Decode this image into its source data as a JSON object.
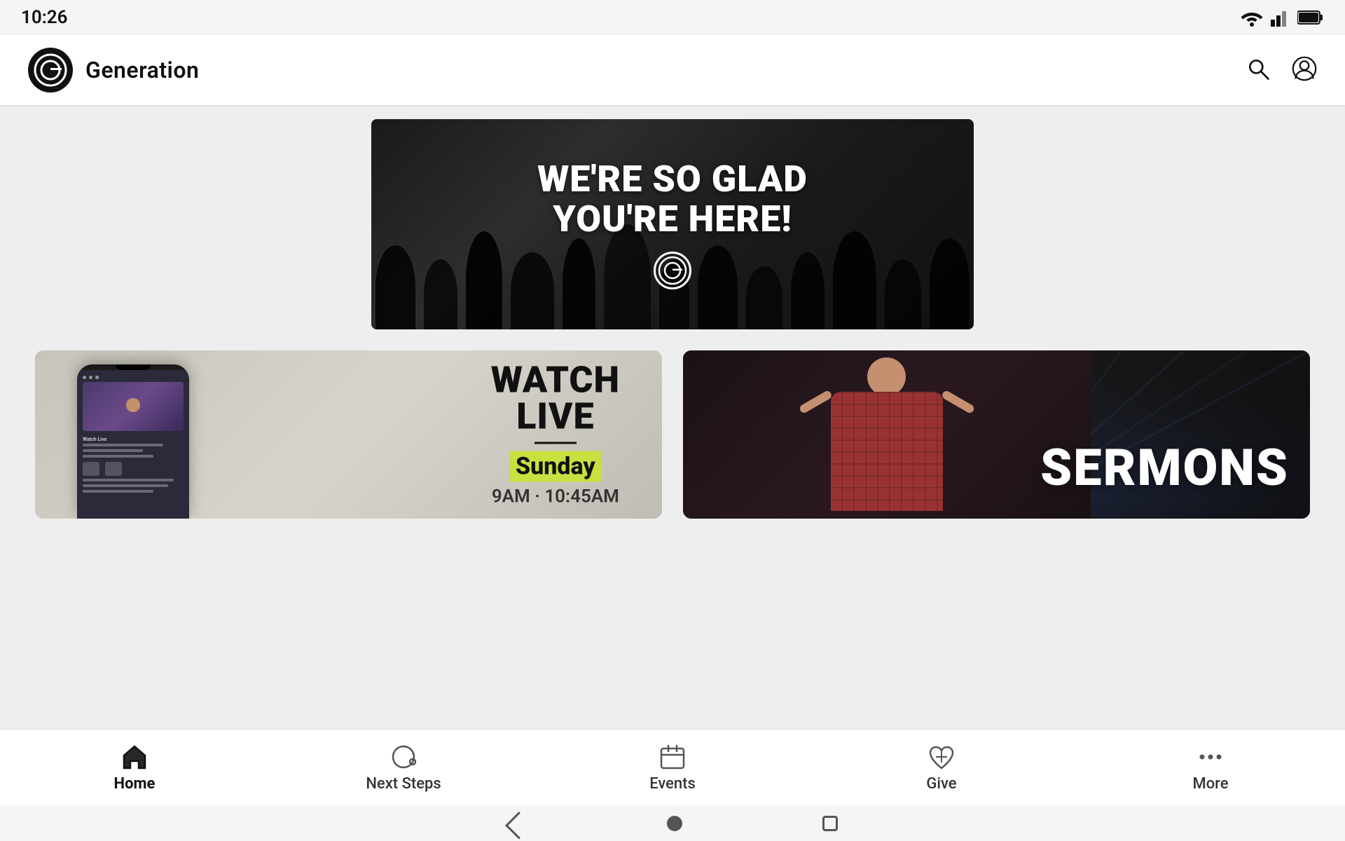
{
  "status_bar": {
    "time": "10:26"
  },
  "app_bar": {
    "title": "Generation",
    "logo_alt": "Generation church logo"
  },
  "hero": {
    "line1": "WE'RE SO GLAD",
    "line2": "YOU'RE HERE!"
  },
  "watch_live": {
    "title_line1": "WATCH",
    "title_line2": "LIVE",
    "day": "Sunday",
    "time": "9AM · 10:45AM"
  },
  "sermons": {
    "label": "SERMONS"
  },
  "nav": {
    "home": "Home",
    "next_steps": "Next Steps",
    "events": "Events",
    "give": "Give",
    "more": "More"
  }
}
